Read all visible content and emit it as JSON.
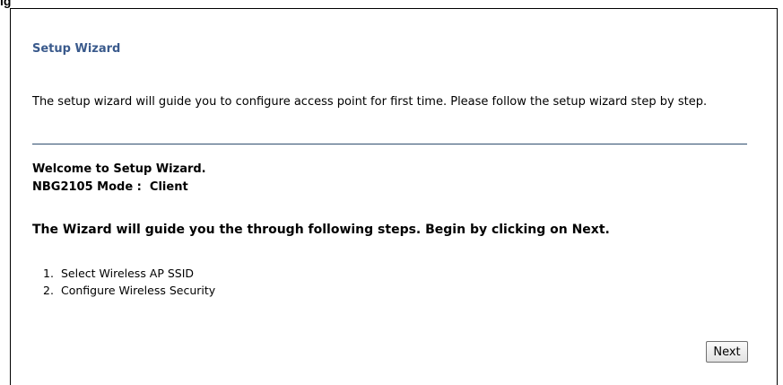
{
  "figure_label": "ig",
  "page_title": "Setup Wizard",
  "intro_text": "The setup wizard will guide you to configure access point for first time. Please follow the setup wizard step by step.",
  "welcome": {
    "line1": "Welcome to Setup Wizard.",
    "line2": "NBG2105 Mode :  Client"
  },
  "guide_text": "The Wizard will guide you the through following steps. Begin by clicking on Next.",
  "steps": [
    {
      "num": "1.",
      "label": "Select Wireless AP SSID"
    },
    {
      "num": "2.",
      "label": "Configure Wireless Security"
    }
  ],
  "buttons": {
    "next_label": "Next"
  },
  "colors": {
    "title": "#3a5a8c",
    "divider": "#2e4d6e"
  }
}
